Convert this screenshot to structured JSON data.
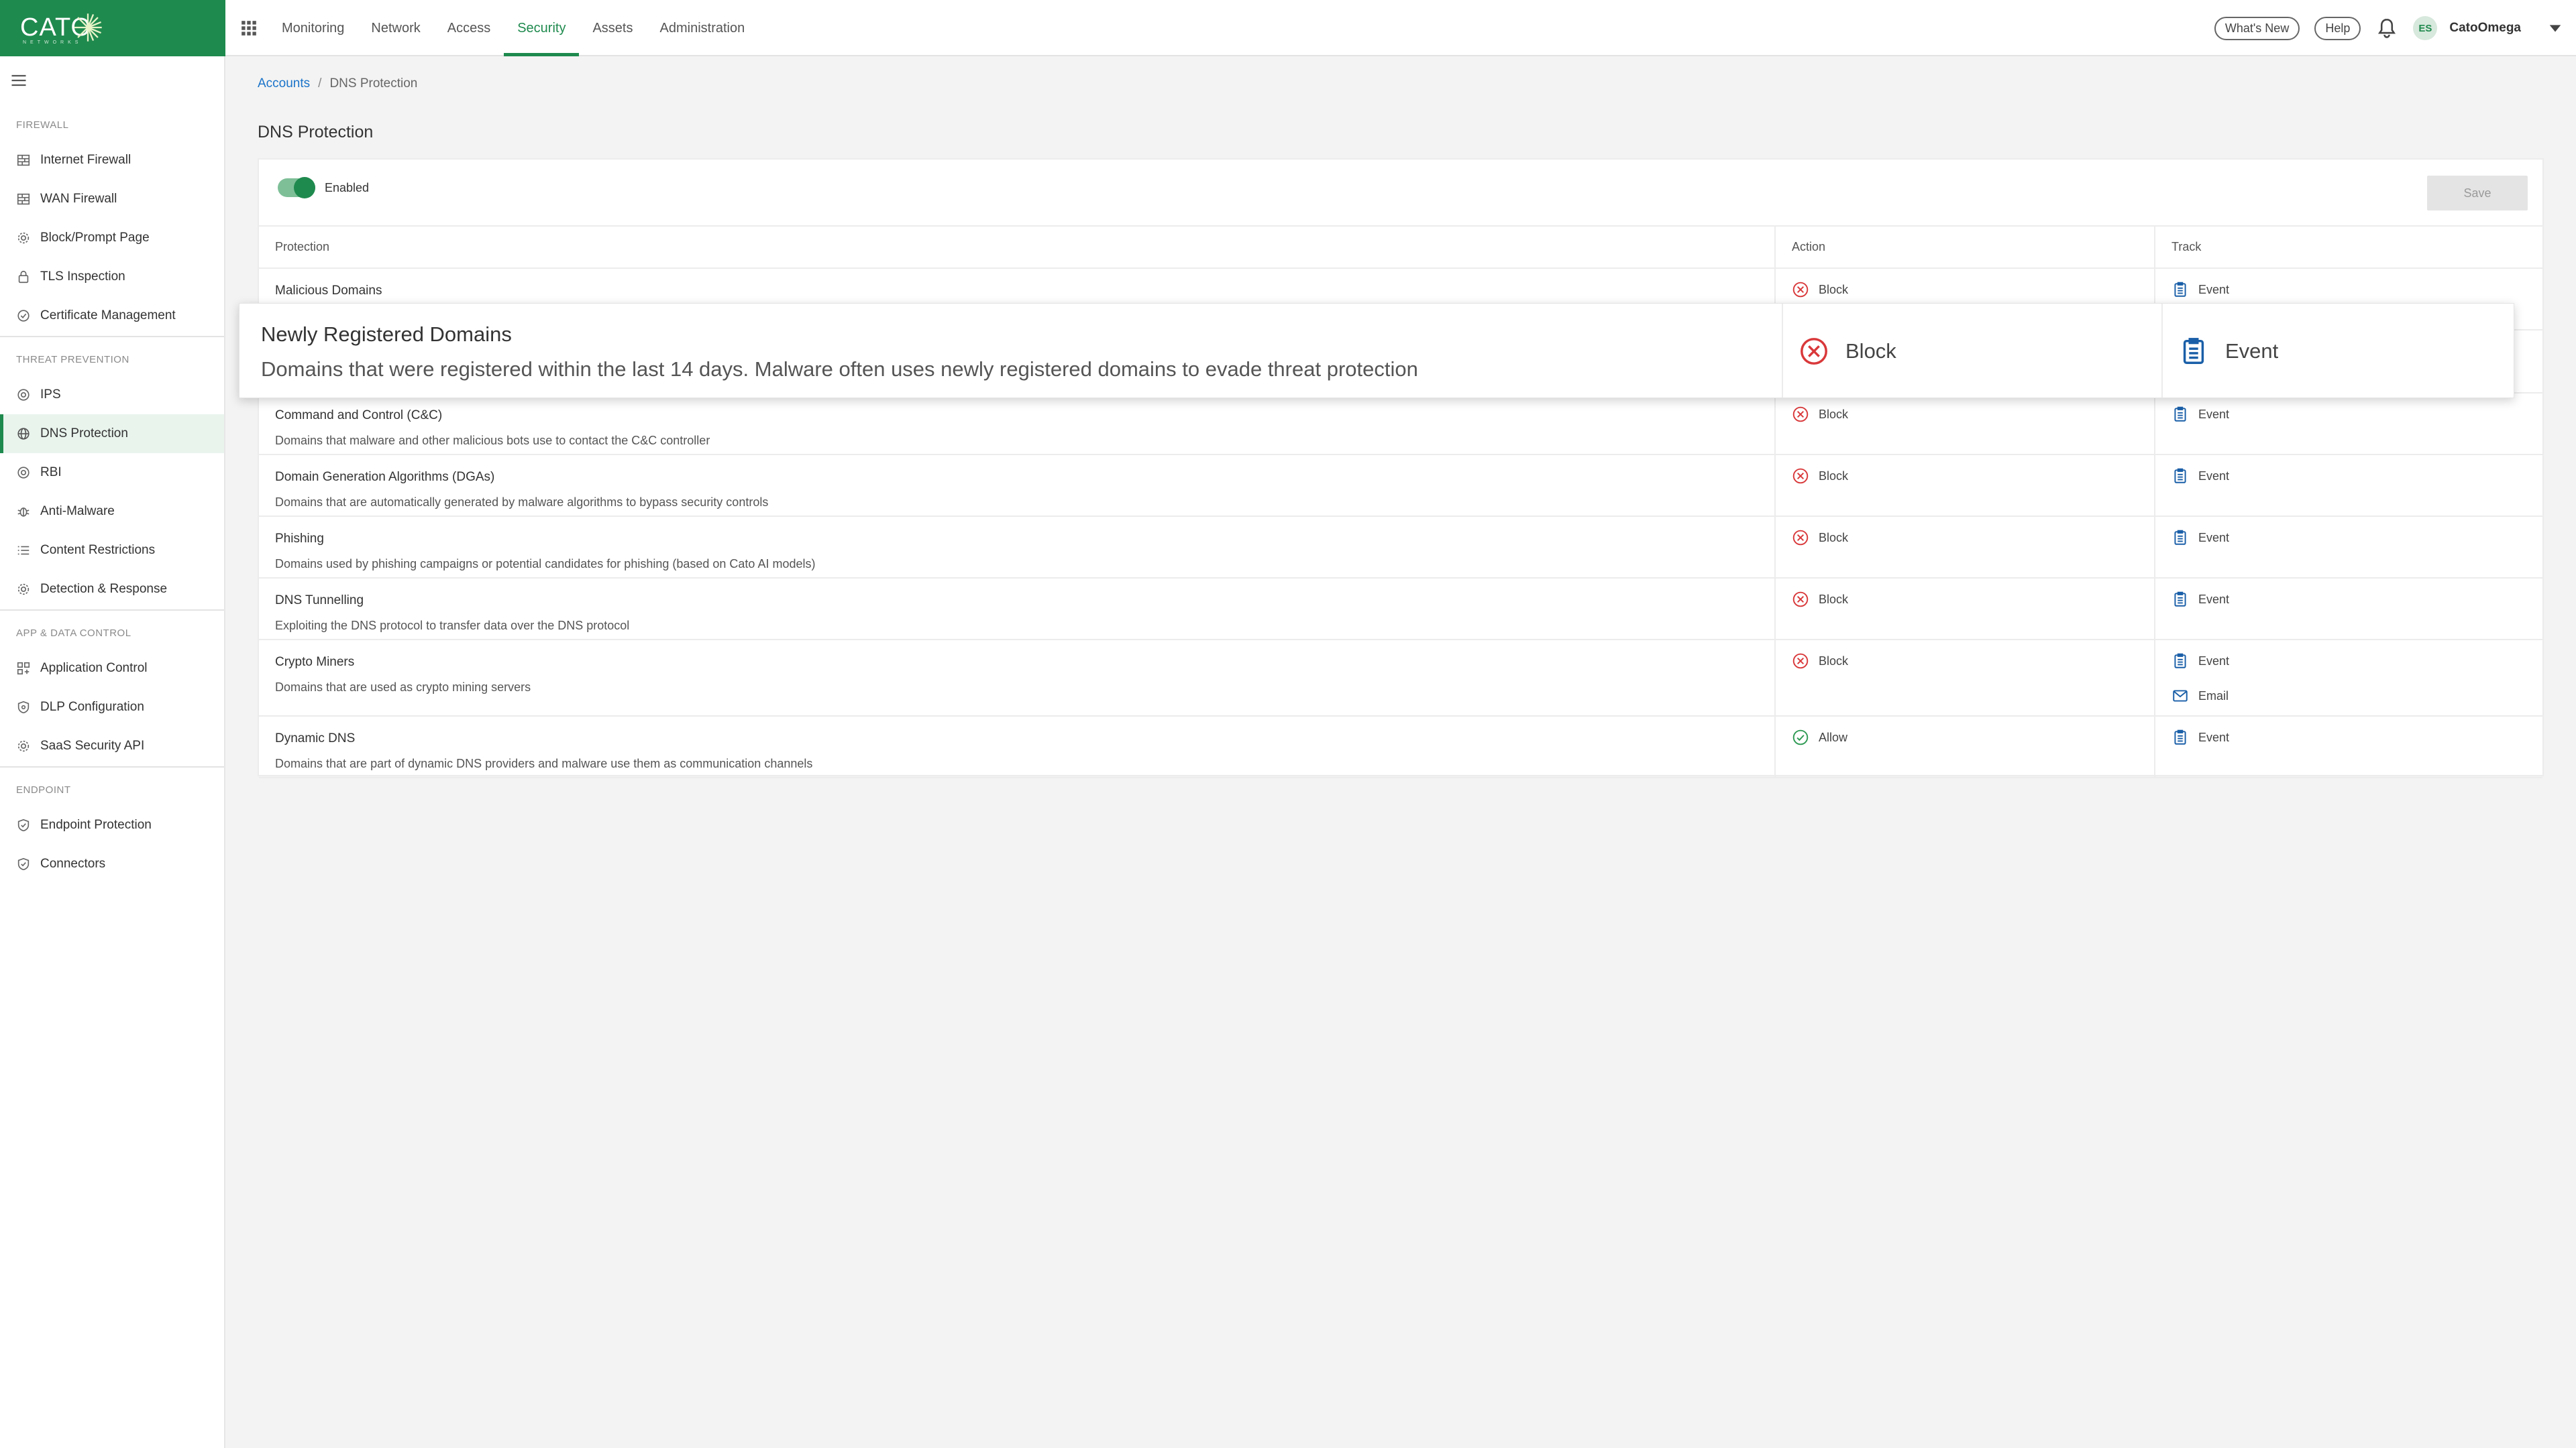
{
  "brand": {
    "logo_text": "CATO",
    "logo_sub": "NETWORKS",
    "accent": "#1f8a4e"
  },
  "topnav": {
    "items": [
      {
        "label": "Monitoring"
      },
      {
        "label": "Network"
      },
      {
        "label": "Access"
      },
      {
        "label": "Security",
        "active": true
      },
      {
        "label": "Assets"
      },
      {
        "label": "Administration"
      }
    ],
    "whats_new": "What's New",
    "help": "Help",
    "avatar_initials": "ES",
    "account_name": "CatoOmega"
  },
  "sidebar": {
    "sections": [
      {
        "title": "FIREWALL",
        "items": [
          {
            "label": "Internet Firewall",
            "icon": "firewall-icon"
          },
          {
            "label": "WAN Firewall",
            "icon": "firewall-icon"
          },
          {
            "label": "Block/Prompt Page",
            "icon": "gear-icon"
          },
          {
            "label": "TLS Inspection",
            "icon": "lock-icon"
          },
          {
            "label": "Certificate Management",
            "icon": "certificate-icon"
          }
        ]
      },
      {
        "title": "THREAT PREVENTION",
        "items": [
          {
            "label": "IPS",
            "icon": "target-icon"
          },
          {
            "label": "DNS Protection",
            "icon": "globe-icon",
            "active": true
          },
          {
            "label": "RBI",
            "icon": "target-icon"
          },
          {
            "label": "Anti-Malware",
            "icon": "bug-icon"
          },
          {
            "label": "Content Restrictions",
            "icon": "list-icon"
          },
          {
            "label": "Detection & Response",
            "icon": "gear-icon"
          }
        ]
      },
      {
        "title": "APP & DATA CONTROL",
        "items": [
          {
            "label": "Application Control",
            "icon": "apps-icon"
          },
          {
            "label": "DLP Configuration",
            "icon": "shield-icon"
          },
          {
            "label": "SaaS Security API",
            "icon": "gear-icon"
          }
        ]
      },
      {
        "title": "ENDPOINT",
        "items": [
          {
            "label": "Endpoint Protection",
            "icon": "shield-icon"
          },
          {
            "label": "Connectors",
            "icon": "shield-icon"
          }
        ]
      }
    ]
  },
  "breadcrumb": {
    "root": "Accounts",
    "separator": "/",
    "current": "DNS Protection"
  },
  "page": {
    "title": "DNS Protection"
  },
  "panel": {
    "toggle_label": "Enabled",
    "toggle_on": true,
    "save_label": "Save",
    "columns": {
      "protection": "Protection",
      "action": "Action",
      "track": "Track"
    }
  },
  "rows": [
    {
      "name": "Malicious Domains",
      "desc": "",
      "action": "Block",
      "track": [
        "Event"
      ]
    },
    {
      "name": "Newly Registered Domains",
      "desc": "Domains that were registered within the last 14 days. Malware often uses newly registered domains to evade threat protection",
      "action": "Block",
      "track": [
        "Event"
      ]
    },
    {
      "name": "Command and Control (C&C)",
      "desc": "Domains that malware and other malicious bots use to contact the C&C controller",
      "action": "Block",
      "track": [
        "Event"
      ]
    },
    {
      "name": "Domain Generation Algorithms (DGAs)",
      "desc": "Domains that are automatically generated by malware algorithms to bypass security controls",
      "action": "Block",
      "track": [
        "Event"
      ]
    },
    {
      "name": "Phishing",
      "desc": "Domains used by phishing campaigns or potential candidates for phishing (based on Cato AI models)",
      "action": "Block",
      "track": [
        "Event"
      ]
    },
    {
      "name": "DNS Tunnelling",
      "desc": "Exploiting the DNS protocol to transfer data over the DNS protocol",
      "action": "Block",
      "track": [
        "Event"
      ]
    },
    {
      "name": "Crypto Miners",
      "desc": "Domains that are used as crypto mining servers",
      "action": "Block",
      "track": [
        "Event",
        "Email"
      ]
    },
    {
      "name": "Dynamic DNS",
      "desc": "Domains that are part of dynamic DNS providers and malware use them as communication channels",
      "action": "Allow",
      "track": [
        "Event"
      ]
    }
  ],
  "colors": {
    "block": "#d9383a",
    "allow": "#2e9a53",
    "track": "#1a5fa8"
  }
}
